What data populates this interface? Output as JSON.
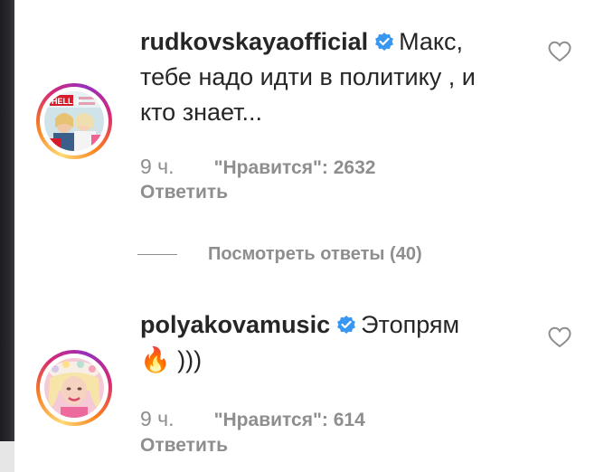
{
  "comments": [
    {
      "username": "rudkovskayaofficial",
      "verified": true,
      "text_lines": [
        "Макс,",
        "тебе надо идти в политику , и",
        "кто знает..."
      ],
      "time": "9 ч.",
      "likes": "\"Нравится\": 2632",
      "reply": "Ответить",
      "avatar_caption": "HELLO!"
    },
    {
      "username": "polyakovamusic",
      "verified": true,
      "text_lines": [
        "Этопрям",
        "🔥 )))"
      ],
      "time": "9 ч.",
      "likes": "\"Нравится\": 614",
      "reply": "Ответить"
    }
  ],
  "view_replies": "Посмотреть ответы (40)",
  "colors": {
    "text": "#262626",
    "secondary": "#8e8e8e",
    "verified_blue": "#3897f0",
    "story_ring": [
      "#feda75",
      "#fa7e1e",
      "#d62976",
      "#962fbf"
    ]
  },
  "icons": [
    "verified-badge-icon",
    "heart-icon",
    "fire-emoji"
  ]
}
